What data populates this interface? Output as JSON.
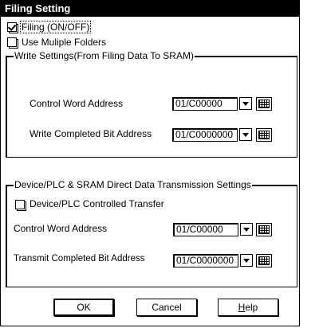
{
  "window": {
    "title": "Filing Setting"
  },
  "filing": {
    "label": "Filing (ON/OFF)",
    "checked": true
  },
  "multiple_folders": {
    "label": "Use Muliple Folders",
    "checked": false
  },
  "write_group": {
    "legend": "Write Settings(From Filing Data To SRAM)",
    "control_word_label": "Control Word Address",
    "control_word_value": "01/C00000",
    "completed_bit_label": "Write Completed Bit Address",
    "completed_bit_value": "01/C0000000"
  },
  "transmit_group": {
    "legend": "Device/PLC & SRAM Direct Data Transmission Settings",
    "controlled_transfer_label": "Device/PLC Controlled Transfer",
    "controlled_transfer_checked": false,
    "control_word_label": "Control Word Address",
    "control_word_value": "01/C00000",
    "completed_bit_label": "Transmit Completed Bit Address",
    "completed_bit_value": "01/C0000000"
  },
  "buttons": {
    "ok": "OK",
    "cancel": "Cancel",
    "help_first": "H",
    "help_rest": "elp"
  }
}
